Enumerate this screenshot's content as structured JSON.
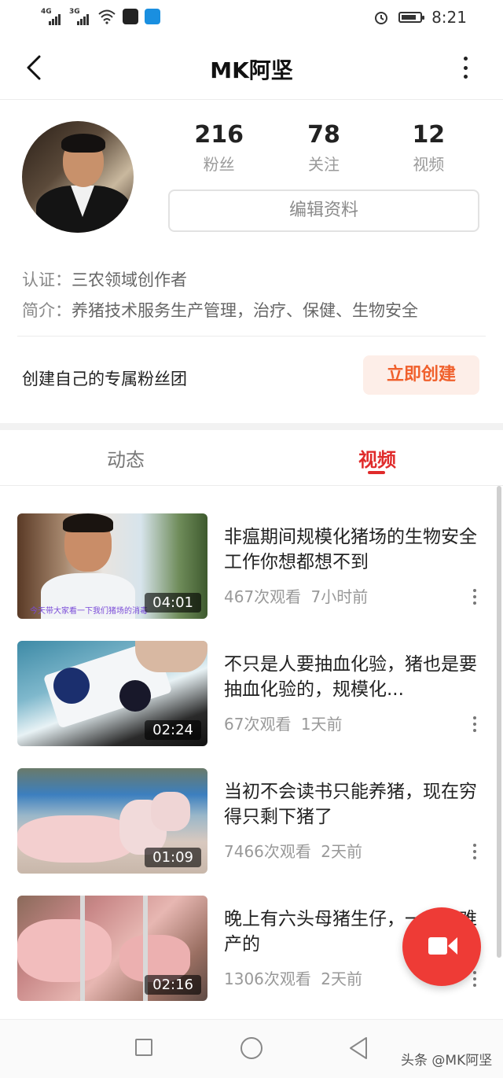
{
  "status_bar": {
    "signal1": "4G",
    "signal2": "3G",
    "time": "8:21"
  },
  "header": {
    "title": "MK阿坚"
  },
  "profile": {
    "stats": [
      {
        "value": "216",
        "label": "粉丝"
      },
      {
        "value": "78",
        "label": "关注"
      },
      {
        "value": "12",
        "label": "视频"
      }
    ],
    "edit_label": "编辑资料",
    "cert_key": "认证：",
    "cert_value": "三农领域创作者",
    "intro_key": "简介：",
    "intro_value": "养猪技术服务生产管理，治疗、保健、生物安全",
    "fan_group_text": "创建自己的专属粉丝团",
    "fan_group_button": "立即创建"
  },
  "tabs": {
    "dynamic": "动态",
    "video": "视频"
  },
  "videos": [
    {
      "title": "非瘟期间规模化猪场的生物安全工作你想都想不到",
      "duration": "04:01",
      "views": "467次观看",
      "time": "7小时前",
      "subtitle": "今天带大家看一下我们猪场的消毒"
    },
    {
      "title": "不只是人要抽血化验，猪也是要抽血化验的，规模化...",
      "duration": "02:24",
      "views": "67次观看",
      "time": "1天前"
    },
    {
      "title": "当初不会读书只能养猪，现在穷得只剩下猪了",
      "duration": "01:09",
      "views": "7466次观看",
      "time": "2天前"
    },
    {
      "title": "晚上有六头母猪生仔，一头有难产的",
      "duration": "02:16",
      "views": "1306次观看",
      "time": "2天前"
    }
  ],
  "watermark": "头条 @MK阿坚",
  "icons": [
    "back-arrow-icon",
    "more-icon",
    "video-camera-icon",
    "recent-apps-icon",
    "home-icon",
    "nav-back-icon",
    "alarm-icon",
    "battery-icon",
    "wifi-icon"
  ],
  "colors": {
    "accent": "#e02b2b",
    "fab": "#ee3b36",
    "fan_button_text": "#f0602c",
    "fan_button_bg": "#fdeee8"
  }
}
